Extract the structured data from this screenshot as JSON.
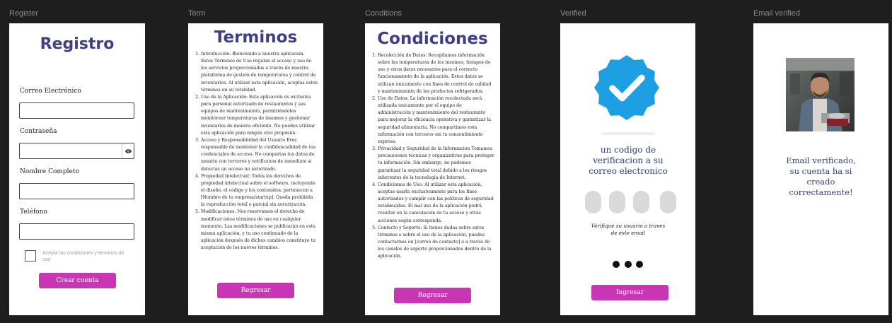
{
  "frames": {
    "register_label": "Register",
    "terms_label": "Term",
    "conditions_label": "Conditions",
    "verified_label": "Verified",
    "email_label": "Email verified"
  },
  "register": {
    "title": "Registro",
    "email_label": "Correo Electrónico",
    "password_label": "Contraseña",
    "name_label": "Nombre Completo",
    "phone_label": "Teléfono",
    "accept_label": "Acepta las condiciones y terminos de uso",
    "create_button": "Crear cuenta",
    "eye_icon": "eye-icon"
  },
  "terms": {
    "title": "Terminos",
    "items": [
      "Introducción: Bienvenido a nuestra aplicación. Estos Términos de Uso regulan el acceso y uso de los servicios proporcionados a través de nuestra plataforma de gestión de temperaturas y control de inventarios. Al utilizar esta aplicación, aceptas estos términos en su totalidad.",
      "Uso de la Aplicación: Esta aplicación es exclusiva para personal autorizado de restaurantes y sus equipos de mantenimiento, permitiéndoles monitorear temperaturas de insumos y gestionar inventarios de manera eficiente. No puedes utilizar esta aplicación para ningún otro propósito.",
      "Acceso y Responsabilidad del Usuario Eres responsable de mantener la confidencialidad de tus credenciales de acceso. No compartas tus datos de usuario con terceros y notifícanos de inmediato si detectas un acceso no autorizado.",
      "Propiedad Intelectual: Todos los derechos de propiedad intelectual sobre el software, incluyendo el diseño, el código y los contenidos, pertenecen a [Nombre de tu empresa/startup]. Queda prohibida la reproducción total o parcial sin autorización.",
      "Modificaciones: Nos reservamos el derecho de modificar estos términos de uso en cualquier momento. Las modificaciones se publicarán en esta misma aplicación, y tu uso continuado de la aplicación después de dichos cambios constituye tu aceptación de los nuevos términos."
    ],
    "back_button": "Regresar"
  },
  "conditions": {
    "title": "Condiciones",
    "items": [
      "Recolección de Datos: Recopilamos información sobre las temperaturas de los insumos, tiempos de uso y otros datos necesarios para el correcto funcionamiento de la aplicación. Estos datos se utilizan únicamente con fines de control de calidad y mantenimiento de los productos refrigerados.",
      "Uso de Datos: La información recolectada será utilizada únicamente por el equipo de administración y mantenimiento del restaurante para mejorar la eficiencia operativa y garantizar la seguridad alimentaria. No compartimos esta información con terceros sin tu consentimiento expreso.",
      "Privacidad y Seguridad de la Información Tomamos precauciones técnicas y organizativas para proteger tu información. Sin embargo, no podemos garantizar la seguridad total debido a los riesgos inherentes de la tecnología de Internet.",
      "Condiciones de Uso: Al utilizar esta aplicación, aceptas usarla exclusivamente para los fines autorizados y cumplir con las políticas de seguridad establecidas. El mal uso de la aplicación podrá resultar en la cancelación de tu acceso y otras acciones según corresponda.",
      "Contacto y Soporte: Si tienes dudas sobre estos términos o sobre el uso de la aplicación, puedes contactarnos en [correo de contacto] o a través de los canales de soporte proporcionados dentro de la aplicación."
    ],
    "back_button": "Regresar"
  },
  "verified": {
    "badge_icon": "verified-check-icon",
    "message": "un codigo de verificacion a su correo electronico",
    "note": "Verifique su usuario a traves de este email",
    "enter_button": "Ingresar",
    "badge_color": "#1e9fe3"
  },
  "email_verified": {
    "photo": "chef-photo",
    "message": "Email verificado, su cuenta ha si creado correctamente!"
  },
  "colors": {
    "accent": "#c936b4",
    "title": "#3e3f87",
    "message": "#2f3f7f"
  }
}
